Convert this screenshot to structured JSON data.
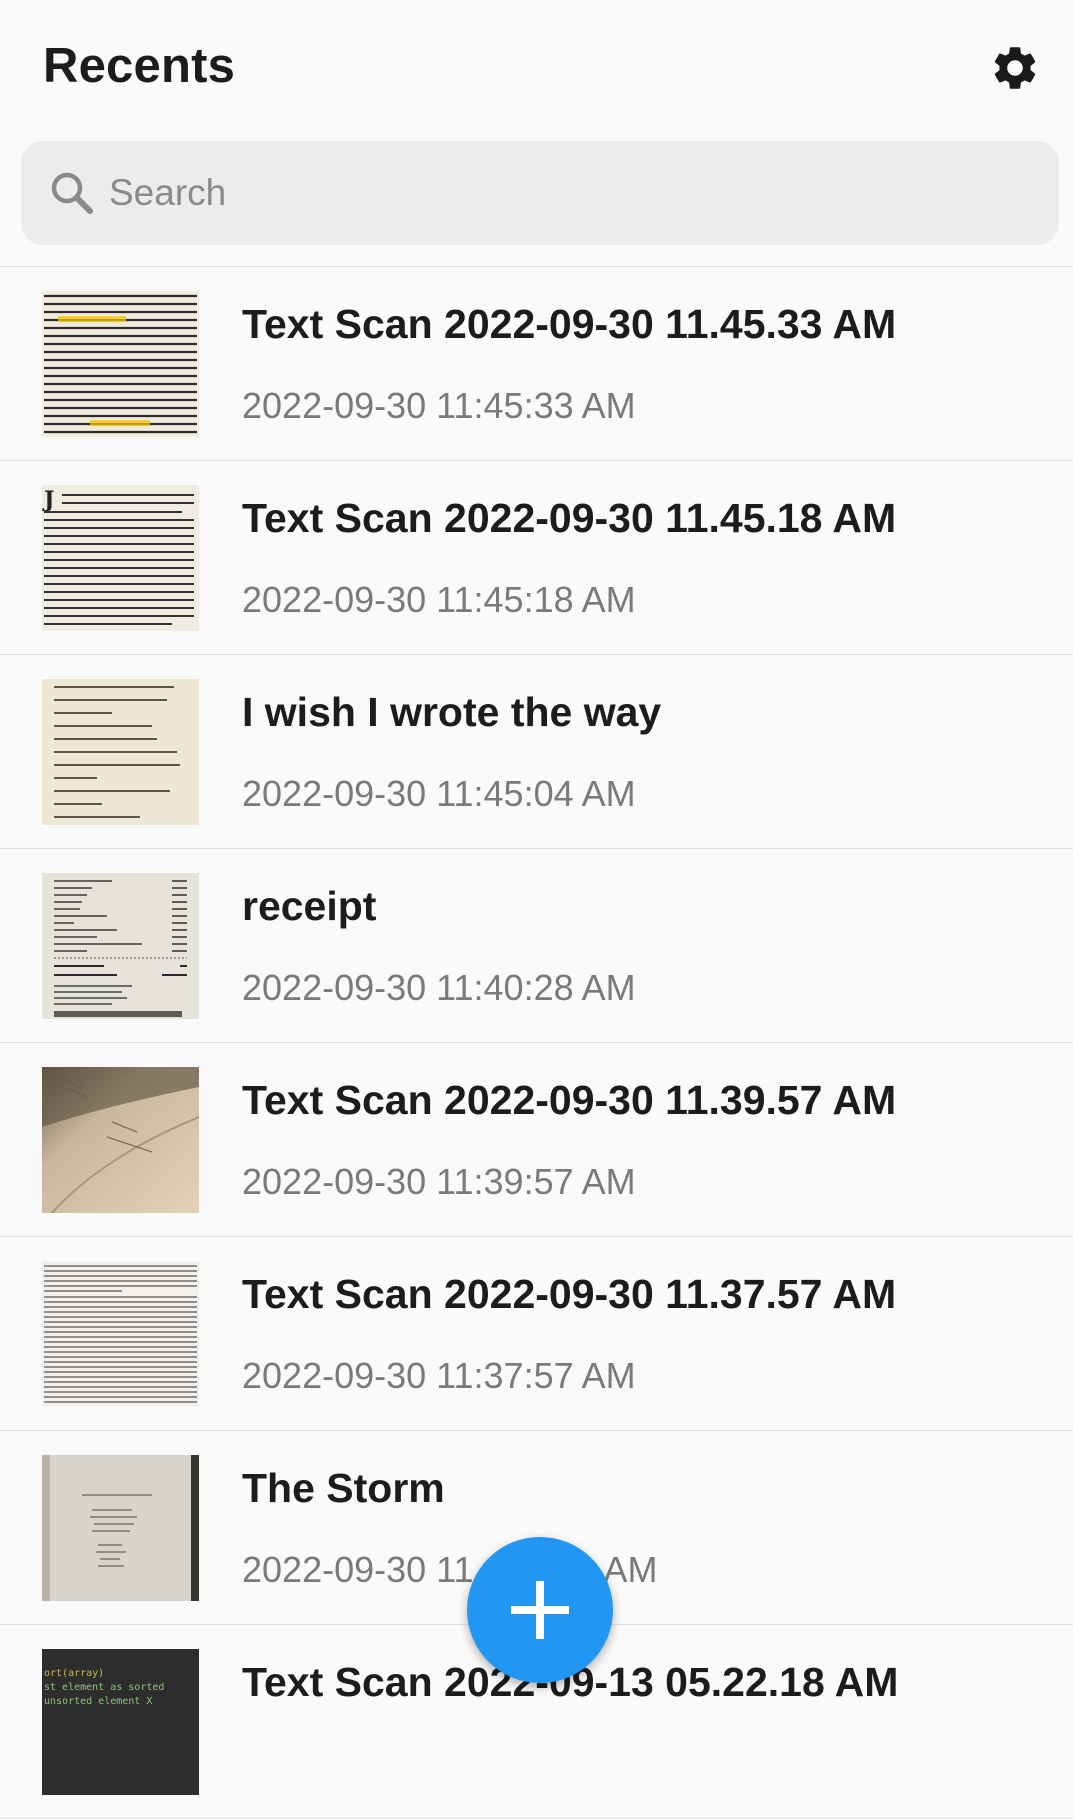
{
  "header": {
    "title": "Recents",
    "settings_icon": "gear-icon"
  },
  "search": {
    "placeholder": "Search",
    "value": "",
    "icon": "search-icon"
  },
  "items": [
    {
      "title": "Text Scan 2022-09-30 11.45.33 AM",
      "date": "2022-09-30 11:45:33 AM",
      "thumb": "highlighted-text-page"
    },
    {
      "title": "Text Scan 2022-09-30 11.45.18 AM",
      "date": "2022-09-30 11:45:18 AM",
      "thumb": "serif-text-page"
    },
    {
      "title": "I wish I wrote the way",
      "date": "2022-09-30 11:45:04 AM",
      "thumb": "poem-page"
    },
    {
      "title": "receipt",
      "date": "2022-09-30 11:40:28 AM",
      "thumb": "receipt"
    },
    {
      "title": "Text Scan 2022-09-30 11.39.57 AM",
      "date": "2022-09-30 11:39:57 AM",
      "thumb": "open-book-photo"
    },
    {
      "title": "Text Scan 2022-09-30 11.37.57 AM",
      "date": "2022-09-30 11:37:57 AM",
      "thumb": "dense-text-page"
    },
    {
      "title": "The Storm",
      "date": "2022-09-30 11",
      "date_tail": "AM",
      "thumb": "poem-paper-photo"
    },
    {
      "title": "Text Scan 2022-09-13 05.22.18 AM",
      "date": "",
      "thumb": "code-screenshot"
    }
  ],
  "fab": {
    "icon": "plus-icon",
    "color": "#2196f3"
  },
  "colors": {
    "background": "#fafafa",
    "search_bg": "#ececec",
    "accent": "#2196f3",
    "title_text": "#1c1c1c",
    "date_text": "#7a7a7a"
  },
  "code_thumb_lines": [
    "ort(array)",
    "st element as sorted",
    " unsorted element X"
  ]
}
